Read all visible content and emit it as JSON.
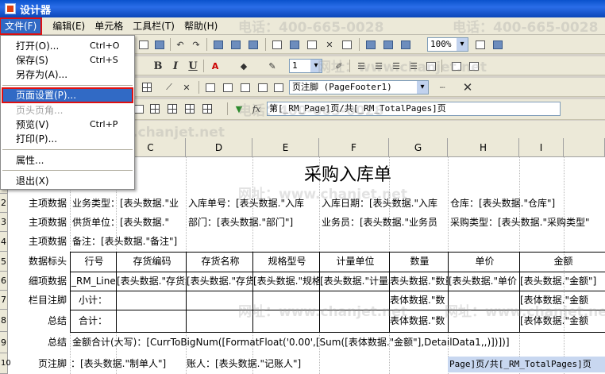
{
  "window": {
    "title": "设计器"
  },
  "menubar": [
    {
      "label": "文件(F)",
      "active": true
    },
    {
      "label": "编辑(E)"
    },
    {
      "label": "单元格"
    },
    {
      "label": "工具栏(T)"
    },
    {
      "label": "帮助(H)"
    }
  ],
  "file_menu": [
    {
      "label": "打开(O)...",
      "shortcut": "Ctrl+O"
    },
    {
      "label": "保存(S)",
      "shortcut": "Ctrl+S"
    },
    {
      "label": "另存为(A)...",
      "shortcut": ""
    },
    {
      "label": "页面设置(P)...",
      "shortcut": "",
      "highlighted": true
    },
    {
      "label": "页头页角...",
      "shortcut": "",
      "disabled": true
    },
    {
      "label": "预览(V)",
      "shortcut": "Ctrl+P"
    },
    {
      "label": "打印(P)...",
      "shortcut": ""
    },
    {
      "label": "属性...",
      "shortcut": ""
    },
    {
      "label": "退出(X)",
      "shortcut": ""
    }
  ],
  "toolbar": {
    "zoom": "100%",
    "line_width": "1",
    "band_select": "页注脚 (PageFooter1)",
    "formula_label": "fx",
    "formula": "第[_RM_Page]页/共[_RM_TotalPages]页"
  },
  "columns": [
    "B",
    "C",
    "D",
    "E",
    "F",
    "G",
    "H",
    "I"
  ],
  "rows": {
    "numbers": [
      "1",
      "2",
      "3",
      "4",
      "5",
      "6",
      "7",
      "8",
      "9",
      "10"
    ],
    "labels": [
      "",
      "主项数据",
      "主项数据",
      "主项数据",
      "数据标头",
      "细项数据",
      "栏目注脚",
      "总结",
      "总结",
      "页注脚"
    ]
  },
  "report": {
    "title": "采购入库单",
    "r2": [
      "业务类型：[表头数据.\"业",
      "入库单号：[表头数据.\"入库",
      "入库日期：[表头数据.\"入库",
      "仓库：[表头数据.\"仓库\"]"
    ],
    "r3": [
      "供货单位：[表头数据.\"",
      "部门：[表头数据.\"部门\"]",
      "业务员：[表头数据.\"业务员",
      "采购类型：[表头数据.\"采购类型\""
    ],
    "r4": "备注：[表头数据.\"备注\"]",
    "headers": [
      "行号",
      "存货编码",
      "存货名称",
      "规格型号",
      "计量单位",
      "数量",
      "单价",
      "金额"
    ],
    "details": [
      "_RM_Line",
      "[表头数据.\"存货编",
      "[表头数据.\"存货名称",
      "[表头数据.\"规格型",
      "[表头数据.\"计量单",
      "表头数据.\"数量",
      "[表头数据.\"单价",
      "[表头数据.\"金额\"]"
    ],
    "r7": {
      "label": "小计：",
      "qty": "表体数据.\"数",
      "amount": "[表体数据.\"金额"
    },
    "r8": {
      "label": "合计：",
      "qty": "表体数据.\"数",
      "amount": "[表体数据.\"金额"
    },
    "r9": "金额合计(大写)：[CurrToBigNum([FormatFloat('0.00',[Sum([表体数据.\"金额\"],DetailData1,,)])])]",
    "r10": [
      "：[表头数据.\"制单人\"]",
      "账人：[表头数据.\"记账人\"]"
    ],
    "footer": "Page]页/共[_RM_TotalPages]页"
  },
  "watermarks": [
    "电话：400-665-0028",
    "网址：www.chanjet.net"
  ]
}
